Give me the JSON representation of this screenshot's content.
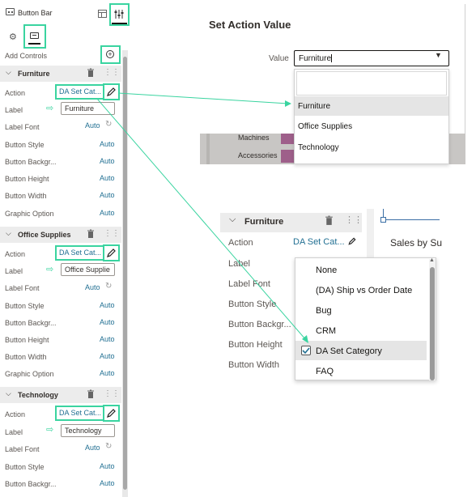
{
  "left_panel": {
    "header_title": "Button Bar",
    "add_controls_label": "Add Controls",
    "sections": [
      {
        "title": "Furniture",
        "properties": [
          {
            "label": "Action",
            "value": "DA Set Cat..."
          },
          {
            "label": "Label",
            "value": "Furniture"
          },
          {
            "label": "Label Font",
            "value": "Auto"
          },
          {
            "label": "Button Style",
            "value": "Auto"
          },
          {
            "label": "Button Backgr...",
            "value": "Auto"
          },
          {
            "label": "Button Height",
            "value": "Auto"
          },
          {
            "label": "Button Width",
            "value": "Auto"
          },
          {
            "label": "Graphic Option",
            "value": "Auto"
          }
        ]
      },
      {
        "title": "Office Supplies",
        "properties": [
          {
            "label": "Action",
            "value": "DA Set Cat..."
          },
          {
            "label": "Label",
            "value": "Office Supplie"
          },
          {
            "label": "Label Font",
            "value": "Auto"
          },
          {
            "label": "Button Style",
            "value": "Auto"
          },
          {
            "label": "Button Backgr...",
            "value": "Auto"
          },
          {
            "label": "Button Height",
            "value": "Auto"
          },
          {
            "label": "Button Width",
            "value": "Auto"
          },
          {
            "label": "Graphic Option",
            "value": "Auto"
          }
        ]
      },
      {
        "title": "Technology",
        "properties": [
          {
            "label": "Action",
            "value": "DA Set Cat..."
          },
          {
            "label": "Label",
            "value": "Technology"
          },
          {
            "label": "Label Font",
            "value": "Auto"
          },
          {
            "label": "Button Style",
            "value": "Auto"
          },
          {
            "label": "Button Backgr...",
            "value": "Auto"
          }
        ]
      }
    ]
  },
  "set_action_dialog": {
    "title": "Set Action Value",
    "value_label": "Value",
    "value_input": "Furniture",
    "options": [
      "",
      "Furniture",
      "Office Supplies",
      "Technology"
    ],
    "selected_option": "Furniture",
    "background_labels": [
      "Machines",
      "Accessories"
    ]
  },
  "action_panel": {
    "section_title": "Furniture",
    "properties": [
      {
        "label": "Action",
        "value": "DA Set Cat..."
      },
      {
        "label": "Label",
        "value": ""
      },
      {
        "label": "Label Font",
        "value": ""
      },
      {
        "label": "Button Style",
        "value": ""
      },
      {
        "label": "Button Backgr...",
        "value": ""
      },
      {
        "label": "Button Height",
        "value": ""
      },
      {
        "label": "Button Width",
        "value": ""
      }
    ],
    "canvas_title_partial": "Sales by Su",
    "action_options": [
      "None",
      "(DA) Ship vs Order Date",
      "Bug",
      "CRM",
      "DA Set Category",
      "FAQ"
    ],
    "selected_action": "DA Set Category"
  },
  "colors": {
    "highlight": "#3ad4a0",
    "link": "#227093",
    "section_bg": "#ececec",
    "selected_row": "#e5e5e5",
    "chart_bar": "#9e5f8a"
  }
}
